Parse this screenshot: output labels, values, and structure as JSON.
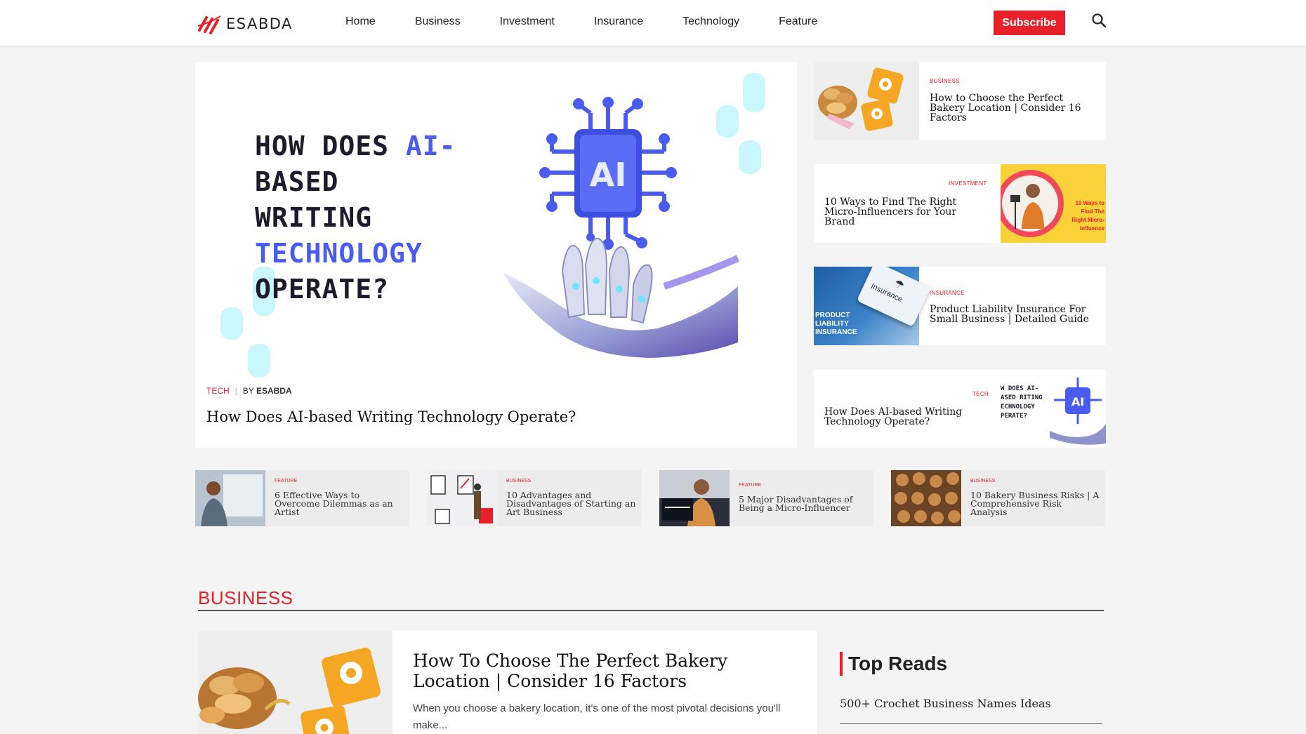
{
  "brand": {
    "name": "ESABDA",
    "accent": "#e8202a",
    "highlight": "#4a5cf0"
  },
  "nav": {
    "items": [
      "Home",
      "Business",
      "Investment",
      "Insurance",
      "Technology",
      "Feature"
    ],
    "subscribe_label": "Subscribe",
    "search_icon": "search-icon"
  },
  "hero": {
    "art_lines": [
      "HOW DOES ",
      "AI-",
      "BASED",
      "WRITING",
      "TECHNOLOGY",
      "OPERATE?"
    ],
    "art_badge": "AI",
    "category": "TECH",
    "by_prefix": "BY",
    "author": "ESABDA",
    "title": "How Does AI-based Writing Technology Operate?"
  },
  "side_cards": [
    {
      "category": "BUSINESS",
      "title": "How to Choose the Perfect Bakery Location | Consider 16 Factors"
    },
    {
      "category": "INVESTMENT",
      "title": "10 Ways to Find The Right Micro-Influencers for Your Brand",
      "thumb_text": "10 Ways to Find The Right Micro-Influence"
    },
    {
      "category": "INSURANCE",
      "title": "Product Liability Insurance For Small Business | Detailed Guide",
      "thumb_text": "PRODUCT LIABILITY INSURANCE",
      "key_text": "Insurance"
    },
    {
      "category": "TECH",
      "title": "How Does AI-based Writing Technology Operate?",
      "thumb_text": "W DOES AI- ASED RITING ECHNOLOGY PERATE?"
    }
  ],
  "strip": [
    {
      "category": "FEATURE",
      "title": "6 Effective Ways to Overcome Dilemmas as an Artist"
    },
    {
      "category": "BUSINESS",
      "title": "10 Advantages and Disadvantages of Starting an Art Business"
    },
    {
      "category": "FEATURE",
      "title": "5 Major Disadvantages of Being a Micro-Influencer"
    },
    {
      "category": "BUSINESS",
      "title": "10 Bakery Business Risks | A Comprehensive Risk Analysis"
    }
  ],
  "business_section": {
    "heading": "BUSINESS",
    "featured_title": "How To Choose The Perfect Bakery Location | Consider 16 Factors",
    "featured_excerpt": "When you choose a bakery location, it's one of the most pivotal decisions you'll make..."
  },
  "top_reads": {
    "heading": "Top Reads",
    "items": [
      "500+ Crochet Business Names Ideas"
    ]
  }
}
